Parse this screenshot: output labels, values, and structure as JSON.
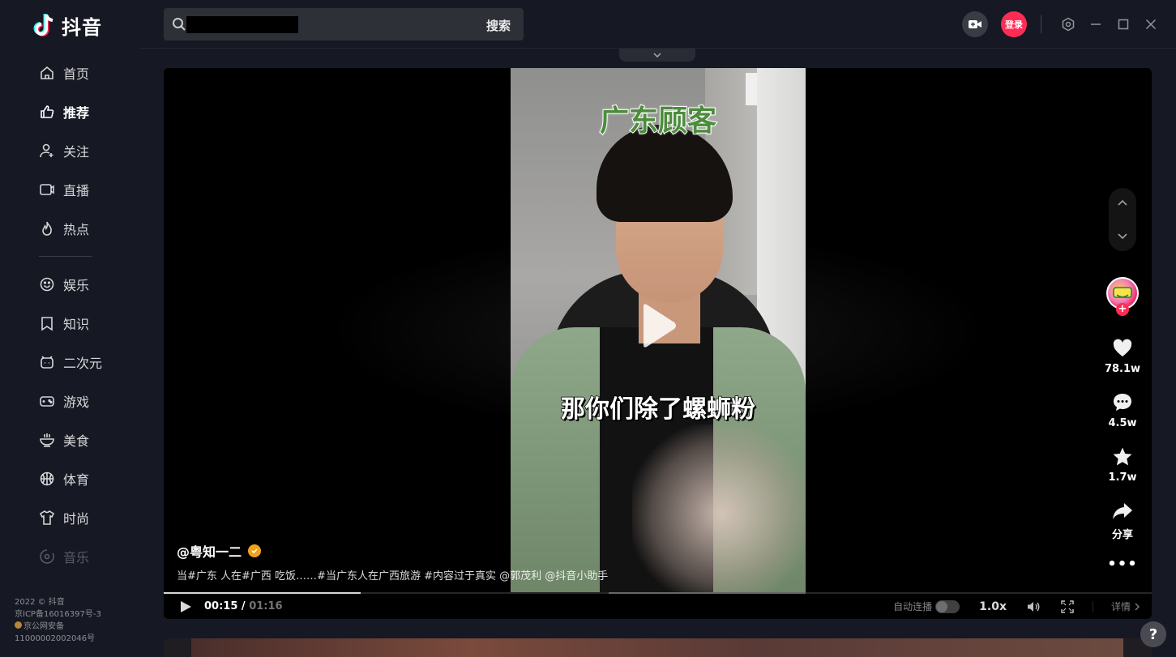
{
  "app": {
    "logo_text": "抖音"
  },
  "sidebar": {
    "items": [
      {
        "label": "首页",
        "icon": "home-icon"
      },
      {
        "label": "推荐",
        "icon": "thumbs-up-icon",
        "active": true
      },
      {
        "label": "关注",
        "icon": "user-plus-icon"
      },
      {
        "label": "直播",
        "icon": "live-icon"
      },
      {
        "label": "热点",
        "icon": "flame-icon"
      }
    ],
    "categories": [
      {
        "label": "娱乐",
        "icon": "smiley-icon"
      },
      {
        "label": "知识",
        "icon": "bookmark-icon"
      },
      {
        "label": "二次元",
        "icon": "alarm-clock-icon"
      },
      {
        "label": "游戏",
        "icon": "gamepad-icon"
      },
      {
        "label": "美食",
        "icon": "bowl-icon"
      },
      {
        "label": "体育",
        "icon": "basketball-icon"
      },
      {
        "label": "时尚",
        "icon": "tshirt-icon"
      },
      {
        "label": "音乐",
        "icon": "music-icon"
      }
    ],
    "footer": [
      "2022 © 抖音",
      "京ICP备16016397号-3",
      "京公网安备",
      "11000002002046号"
    ]
  },
  "header": {
    "search": {
      "value": "",
      "button_label": "搜索"
    },
    "login_label": "登录"
  },
  "video": {
    "caption_top": "广东顾客",
    "caption_mid": "那你们除了螺蛳粉",
    "author": "@粤知一二",
    "description": "当#广东 人在#广西 吃饭……#当广东人在广西旅游 #内容过于真实 @郭茂利 @抖音小助手",
    "likes": "78.1w",
    "comments": "4.5w",
    "favorites": "1.7w",
    "share_label": "分享",
    "more_label": "•••",
    "progress": 0.1995,
    "buffered_start": 0.45,
    "buffered_end": 0.65
  },
  "controls": {
    "time_current": "00:15",
    "time_sep": " / ",
    "time_total": "01:16",
    "autoplay_label": "自动连播",
    "speed_label": "1.0x",
    "detail_label": "详情"
  },
  "colors": {
    "brand_red": "#fe2c55",
    "bg": "#161823",
    "caption_green": "#4c8c3c"
  }
}
